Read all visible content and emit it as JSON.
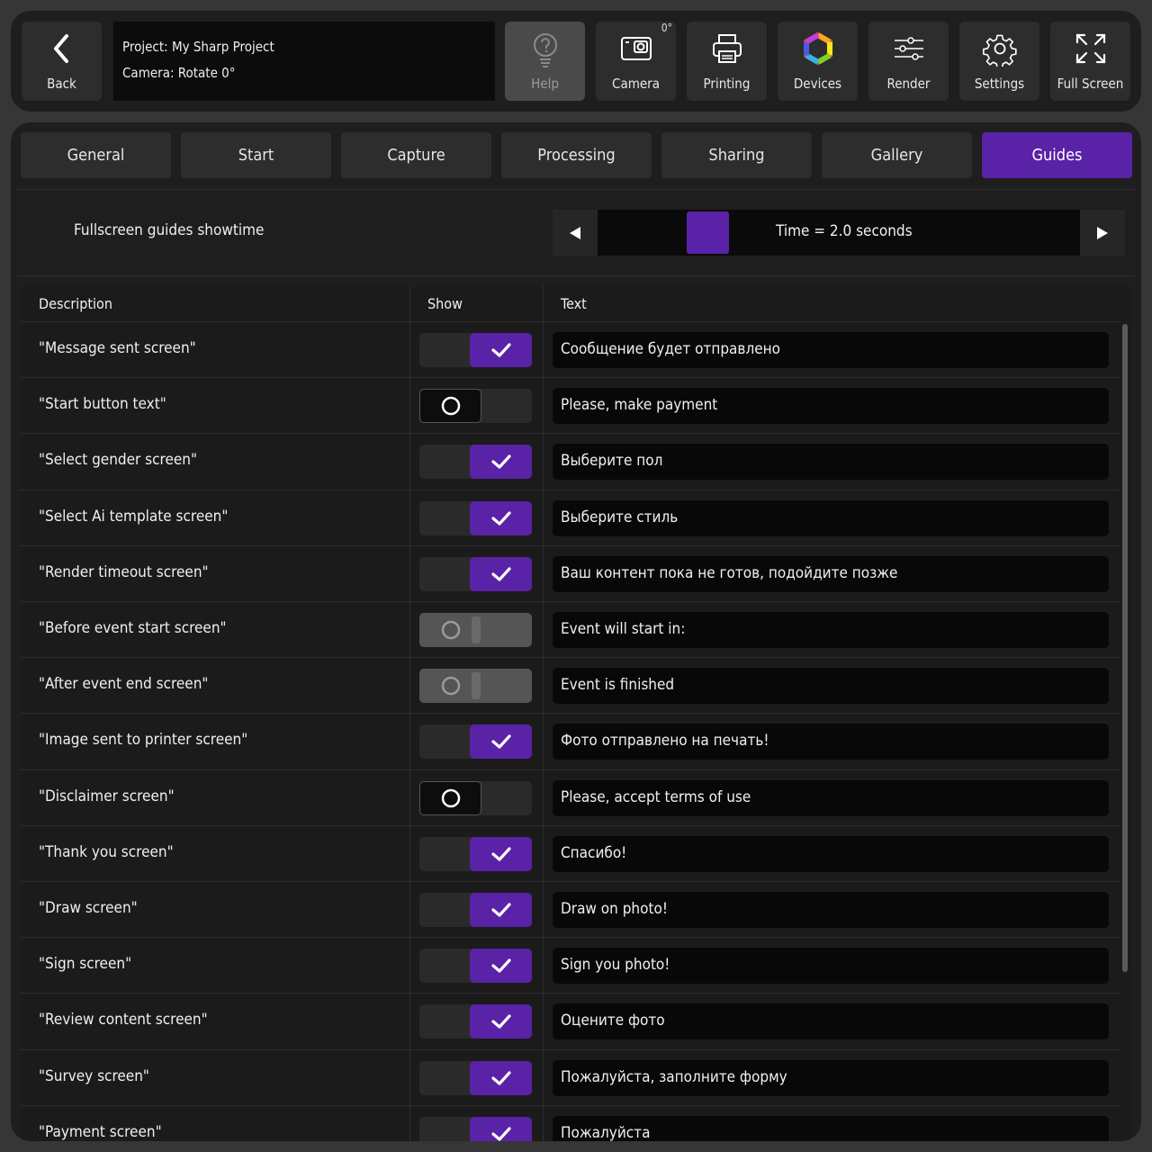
{
  "toolbar": {
    "back_label": "Back",
    "project_line": "Project: My Sharp Project",
    "camera_line": "Camera: Rotate 0°",
    "help_label": "Help",
    "camera_label": "Camera",
    "camera_degree": "0°",
    "printing_label": "Printing",
    "devices_label": "Devices",
    "render_label": "Render",
    "settings_label": "Settings",
    "fullscreen_label": "Full Screen"
  },
  "tabs": [
    {
      "label": "General"
    },
    {
      "label": "Start"
    },
    {
      "label": "Capture"
    },
    {
      "label": "Processing"
    },
    {
      "label": "Sharing"
    },
    {
      "label": "Gallery"
    },
    {
      "label": "Guides",
      "active": true
    }
  ],
  "guides_setting": {
    "label": "Fullscreen guides showtime",
    "value_text": "Time = 2.0 seconds"
  },
  "table": {
    "headers": {
      "description": "Description",
      "show": "Show",
      "text": "Text"
    },
    "rows": [
      {
        "description": "\"Message sent screen\"",
        "show": "on",
        "text": "Сообщение будет отправлено"
      },
      {
        "description": "\"Start button text\"",
        "show": "off",
        "text": "Please, make payment"
      },
      {
        "description": "\"Select gender screen\"",
        "show": "on",
        "text": "Выберите пол"
      },
      {
        "description": "\"Select Ai template screen\"",
        "show": "on",
        "text": "Выберите стиль"
      },
      {
        "description": "\"Render timeout screen\"",
        "show": "on",
        "text": "Ваш контент пока не готов, подойдите позже"
      },
      {
        "description": "\"Before event start screen\"",
        "show": "disabled",
        "text": "Event will start in:"
      },
      {
        "description": "\"After event end screen\"",
        "show": "disabled",
        "text": "Event is finished"
      },
      {
        "description": "\"Image sent to printer screen\"",
        "show": "on",
        "text": "Фото отправлено на печать!"
      },
      {
        "description": "\"Disclaimer screen\"",
        "show": "off",
        "text": "Please, accept terms of use"
      },
      {
        "description": "\"Thank you screen\"",
        "show": "on",
        "text": "Спасибо!"
      },
      {
        "description": "\"Draw screen\"",
        "show": "on",
        "text": "Draw on photo!"
      },
      {
        "description": "\"Sign screen\"",
        "show": "on",
        "text": "Sign you photo!"
      },
      {
        "description": "\"Review content screen\"",
        "show": "on",
        "text": "Оцените фото"
      },
      {
        "description": "\"Survey screen\"",
        "show": "on",
        "text": "Пожалуйста, заполните форму"
      },
      {
        "description": "\"Payment screen\"",
        "show": "on",
        "text": "Пожалуйста"
      }
    ]
  },
  "colors": {
    "accent": "#5a22a6",
    "panel": "#1e1e1e",
    "background": "#363636"
  }
}
